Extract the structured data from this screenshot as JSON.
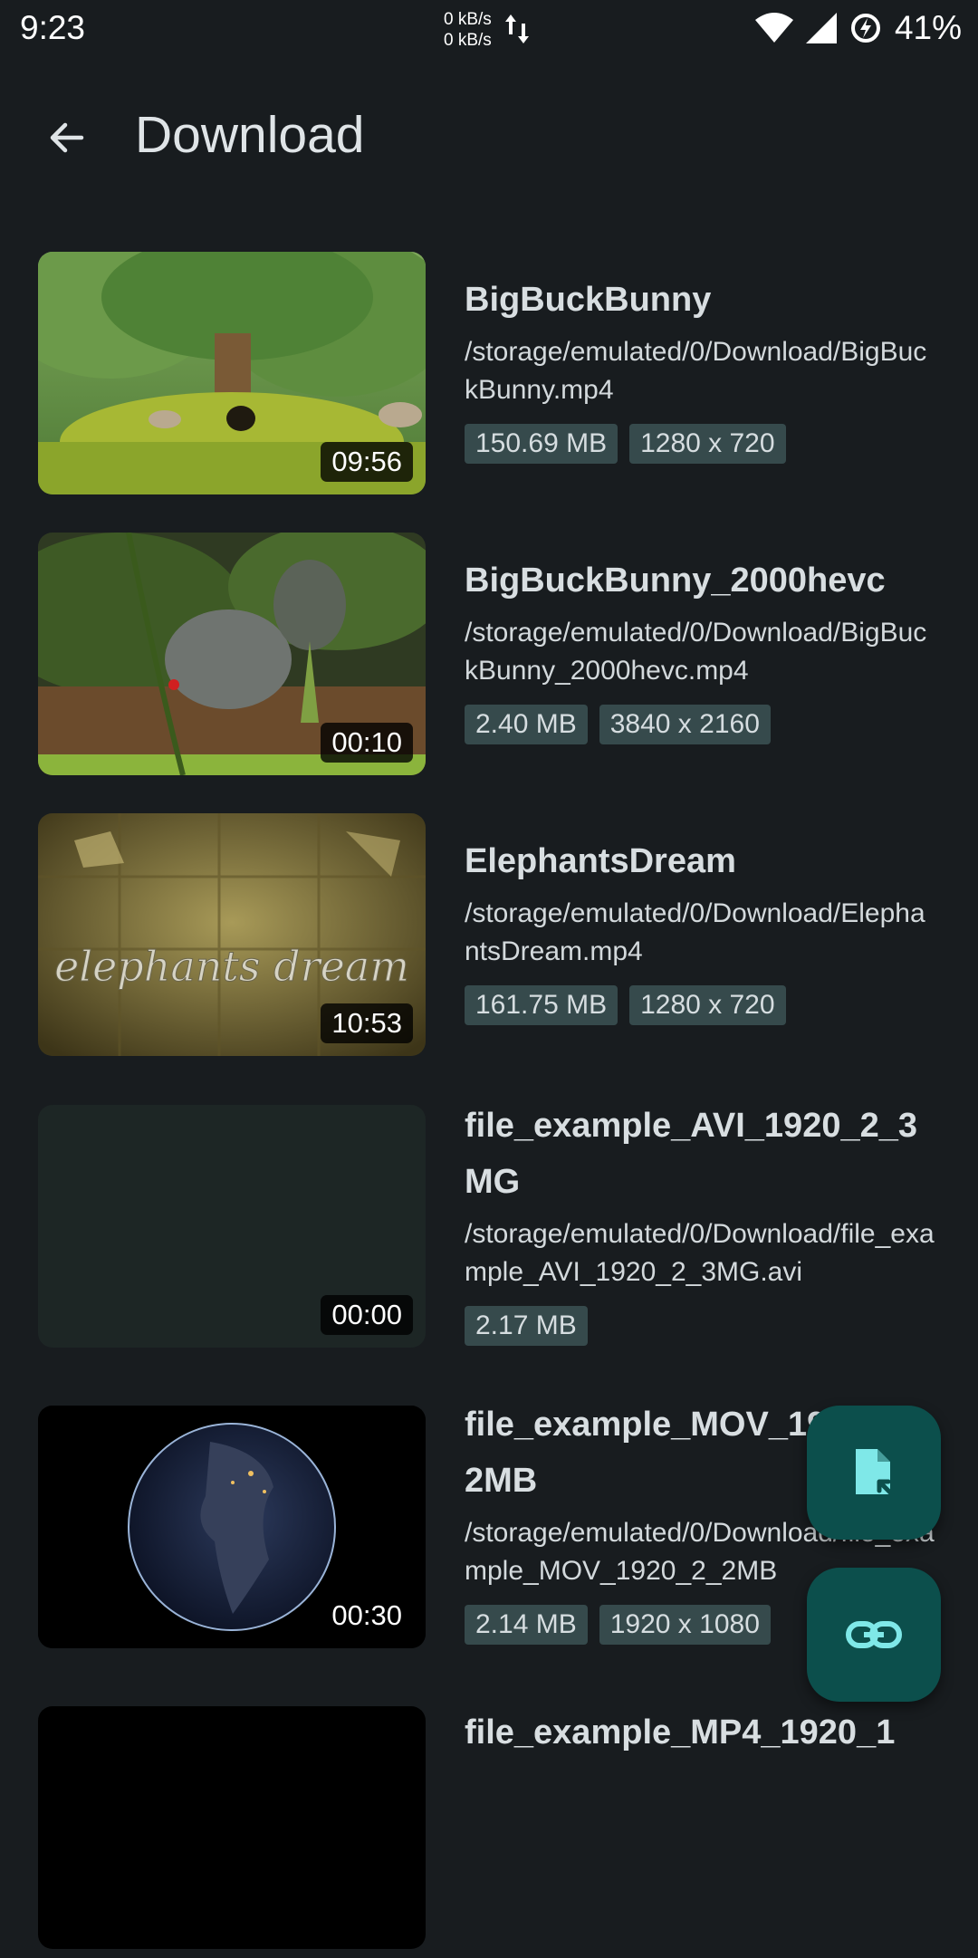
{
  "status_bar": {
    "time": "9:23",
    "net_up": "0 kB/s",
    "net_down": "0 kB/s",
    "battery": "41%",
    "icons": [
      "data-transfer-icon",
      "wifi-icon",
      "cellular-signal-icon",
      "battery-saver-icon"
    ]
  },
  "header": {
    "title": "Download",
    "back_icon": "arrow-back-icon"
  },
  "videos": [
    {
      "title": "BigBuckBunny",
      "path": "/storage/emulated/0/Download/BigBuckBunny.mp4",
      "size": "150.69 MB",
      "resolution": "1280 x 720",
      "duration": "09:56"
    },
    {
      "title": "BigBuckBunny_2000hevc",
      "path": "/storage/emulated/0/Download/BigBuckBunny_2000hevc.mp4",
      "size": "2.40 MB",
      "resolution": "3840 x 2160",
      "duration": "00:10"
    },
    {
      "title": "ElephantsDream",
      "path": "/storage/emulated/0/Download/ElephantsDream.mp4",
      "size": "161.75 MB",
      "resolution": "1280 x 720",
      "duration": "10:53",
      "thumb_text": "elephants dream"
    },
    {
      "title": "file_example_AVI_1920_2_3MG",
      "path": "/storage/emulated/0/Download/file_example_AVI_1920_2_3MG.avi",
      "size": "2.17 MB",
      "duration": "00:00"
    },
    {
      "title": "file_example_MOV_1920_2_2MB",
      "path": "/storage/emulated/0/Download/file_example_MOV_1920_2_2MB",
      "size": "2.14 MB",
      "resolution": "1920 x 1080",
      "duration": "00:30"
    },
    {
      "title": "file_example_MP4_1920_1"
    }
  ],
  "fabs": {
    "open_file_icon": "file-open-icon",
    "link_icon": "link-icon"
  },
  "colors": {
    "background": "#181c1f",
    "chip_bg": "#364a4c",
    "fab_bg": "#0c4f4c",
    "fab_icon": "#7fe8e8"
  }
}
